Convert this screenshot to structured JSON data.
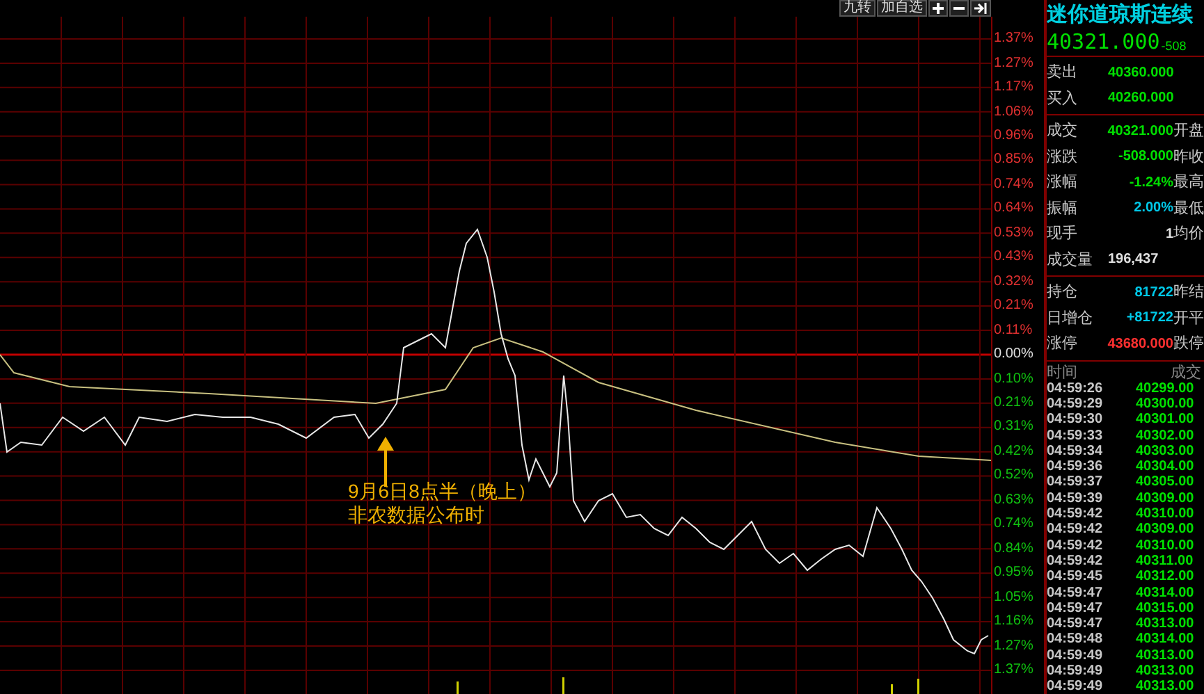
{
  "toolbar": {
    "buttons": [
      {
        "kind": "text",
        "label": "九转"
      },
      {
        "kind": "text",
        "label": "加自选"
      },
      {
        "kind": "plus"
      },
      {
        "kind": "minus"
      },
      {
        "kind": "exit"
      }
    ]
  },
  "chart": {
    "axis_labels": [
      {
        "text": "1.37%",
        "kind": "up"
      },
      {
        "text": "1.27%",
        "kind": "up"
      },
      {
        "text": "1.17%",
        "kind": "up"
      },
      {
        "text": "1.06%",
        "kind": "up"
      },
      {
        "text": "0.96%",
        "kind": "up"
      },
      {
        "text": "0.85%",
        "kind": "up"
      },
      {
        "text": "0.74%",
        "kind": "up"
      },
      {
        "text": "0.64%",
        "kind": "up"
      },
      {
        "text": "0.53%",
        "kind": "up"
      },
      {
        "text": "0.43%",
        "kind": "up"
      },
      {
        "text": "0.32%",
        "kind": "up"
      },
      {
        "text": "0.21%",
        "kind": "up"
      },
      {
        "text": "0.11%",
        "kind": "up"
      },
      {
        "text": "0.00%",
        "kind": "flat"
      },
      {
        "text": "0.10%",
        "kind": "down"
      },
      {
        "text": "0.21%",
        "kind": "down"
      },
      {
        "text": "0.31%",
        "kind": "down"
      },
      {
        "text": "0.42%",
        "kind": "down"
      },
      {
        "text": "0.52%",
        "kind": "down"
      },
      {
        "text": "0.63%",
        "kind": "down"
      },
      {
        "text": "0.74%",
        "kind": "down"
      },
      {
        "text": "0.84%",
        "kind": "down"
      },
      {
        "text": "0.95%",
        "kind": "down"
      },
      {
        "text": "1.05%",
        "kind": "down"
      },
      {
        "text": "1.16%",
        "kind": "down"
      },
      {
        "text": "1.27%",
        "kind": "down"
      },
      {
        "text": "1.37%",
        "kind": "down"
      }
    ],
    "annotation": [
      "9月6日8点半（晚上）",
      "非农数据公布时"
    ]
  },
  "quote": {
    "title": "迷你道琼斯连续",
    "price": "40321.000",
    "change": "-508",
    "sections": [
      {
        "rows": [
          {
            "label": "卖出",
            "value": "40360.000",
            "color": "#00e000"
          },
          {
            "label": "买入",
            "value": "40260.000",
            "color": "#00e000"
          }
        ]
      },
      {
        "rows": [
          {
            "label": "成交",
            "value": "40321.000",
            "color": "#00e000",
            "tail": "开盘"
          },
          {
            "label": "涨跌",
            "value": "-508.000",
            "color": "#00e000",
            "tail": "昨收"
          },
          {
            "label": "涨幅",
            "value": "-1.24%",
            "color": "#00e000",
            "tail": "最高"
          },
          {
            "label": "振幅",
            "value": "2.00%",
            "color": "#00c8e8",
            "tail": "最低"
          },
          {
            "label": "现手",
            "value": "1",
            "color": "#e0e0e0",
            "tail": "均价"
          },
          {
            "label": "成交量",
            "value": "196,437",
            "color": "#e0e0e0"
          }
        ]
      },
      {
        "rows": [
          {
            "label": "持仓",
            "value": "81722",
            "color": "#00c8e8",
            "tail": "昨结"
          },
          {
            "label": "日增仓",
            "value": "+81722",
            "color": "#00c8e8",
            "tail": "开平"
          },
          {
            "label": "涨停",
            "value": "43680.000",
            "color": "#ff3030",
            "tail": "跌停"
          }
        ]
      }
    ]
  },
  "ticks": {
    "columns": [
      "时间",
      "成交"
    ],
    "rows": [
      {
        "time": "04:59:26",
        "price": "40299.00"
      },
      {
        "time": "04:59:29",
        "price": "40300.00"
      },
      {
        "time": "04:59:30",
        "price": "40301.00"
      },
      {
        "time": "04:59:33",
        "price": "40302.00"
      },
      {
        "time": "04:59:34",
        "price": "40303.00"
      },
      {
        "time": "04:59:36",
        "price": "40304.00"
      },
      {
        "time": "04:59:37",
        "price": "40305.00"
      },
      {
        "time": "04:59:39",
        "price": "40309.00"
      },
      {
        "time": "04:59:42",
        "price": "40310.00"
      },
      {
        "time": "04:59:42",
        "price": "40309.00"
      },
      {
        "time": "04:59:42",
        "price": "40310.00"
      },
      {
        "time": "04:59:42",
        "price": "40311.00"
      },
      {
        "time": "04:59:45",
        "price": "40312.00"
      },
      {
        "time": "04:59:47",
        "price": "40314.00"
      },
      {
        "time": "04:59:47",
        "price": "40315.00"
      },
      {
        "time": "04:59:47",
        "price": "40313.00"
      },
      {
        "time": "04:59:48",
        "price": "40314.00"
      },
      {
        "time": "04:59:49",
        "price": "40313.00"
      },
      {
        "time": "04:59:49",
        "price": "40313.00"
      },
      {
        "time": "04:59:49",
        "price": "40313.00"
      }
    ]
  }
}
